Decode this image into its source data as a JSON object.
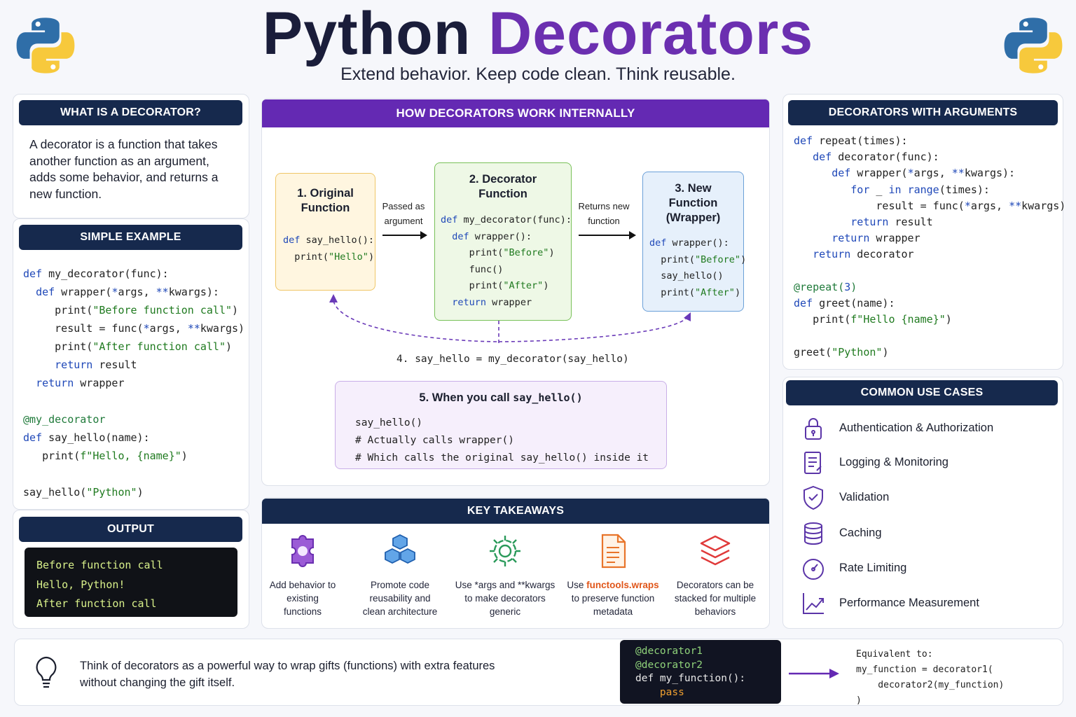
{
  "header": {
    "title_part1": "Python",
    "title_part2": "Decorators",
    "subtitle": "Extend behavior. Keep code clean. Think reusable."
  },
  "what_is": {
    "heading": "WHAT IS A DECORATOR?",
    "text": "A decorator is a function that takes another function as an argument, adds some behavior, and returns a new function."
  },
  "simple_example": {
    "heading": "SIMPLE EXAMPLE"
  },
  "output": {
    "heading": "OUTPUT",
    "lines": [
      "Before function call",
      "Hello, Python!",
      "After function call"
    ]
  },
  "internals": {
    "heading": "HOW DECORATORS WORK INTERNALLY",
    "box1_title": "1. Original Function",
    "box2_title": "2. Decorator Function",
    "box3_title": "3. New Function (Wrapper)",
    "arrow1_label": "Passed as argument",
    "arrow2_label": "Returns new function",
    "step4": "4. say_hello = my_decorator(say_hello)",
    "box5_title_prefix": "5. When you call",
    "box5_title_code": "say_hello()",
    "box5_lines": [
      "say_hello()",
      "# Actually calls wrapper()",
      "# Which calls the original say_hello() inside it"
    ]
  },
  "takeaways": {
    "heading": "KEY TAKEAWAYS",
    "items": [
      {
        "label": "Add behavior to existing functions",
        "icon": "puzzle-icon"
      },
      {
        "label": "Promote code reusability and clean architecture",
        "icon": "cubes-icon"
      },
      {
        "label": "Use *args and **kwargs to make decorators generic",
        "icon": "gear-icon"
      },
      {
        "label_prefix": "Use",
        "label_highlight": "functools.wraps",
        "label_suffix": "to preserve function metadata",
        "icon": "document-icon"
      },
      {
        "label": "Decorators can be stacked for multiple behaviors",
        "icon": "layers-icon"
      }
    ]
  },
  "args_section": {
    "heading": "DECORATORS WITH ARGUMENTS"
  },
  "use_cases": {
    "heading": "COMMON USE CASES",
    "items": [
      {
        "label": "Authentication & Authorization",
        "icon": "lock-icon"
      },
      {
        "label": "Logging & Monitoring",
        "icon": "clipboard-icon"
      },
      {
        "label": "Validation",
        "icon": "shield-check-icon"
      },
      {
        "label": "Caching",
        "icon": "database-icon"
      },
      {
        "label": "Rate Limiting",
        "icon": "gauge-icon"
      },
      {
        "label": "Performance Measurement",
        "icon": "chart-up-icon"
      }
    ]
  },
  "footer": {
    "tip": "Think of decorators as a powerful way to wrap gifts (functions) with extra features without changing the gift itself.",
    "equivalent_label": "Equivalent to:"
  },
  "colors": {
    "navy": "#16294d",
    "purple": "#6429b3",
    "keyword_blue": "#1f48b8",
    "string_green": "#1f7a1f",
    "accent_orange": "#e0561a"
  }
}
